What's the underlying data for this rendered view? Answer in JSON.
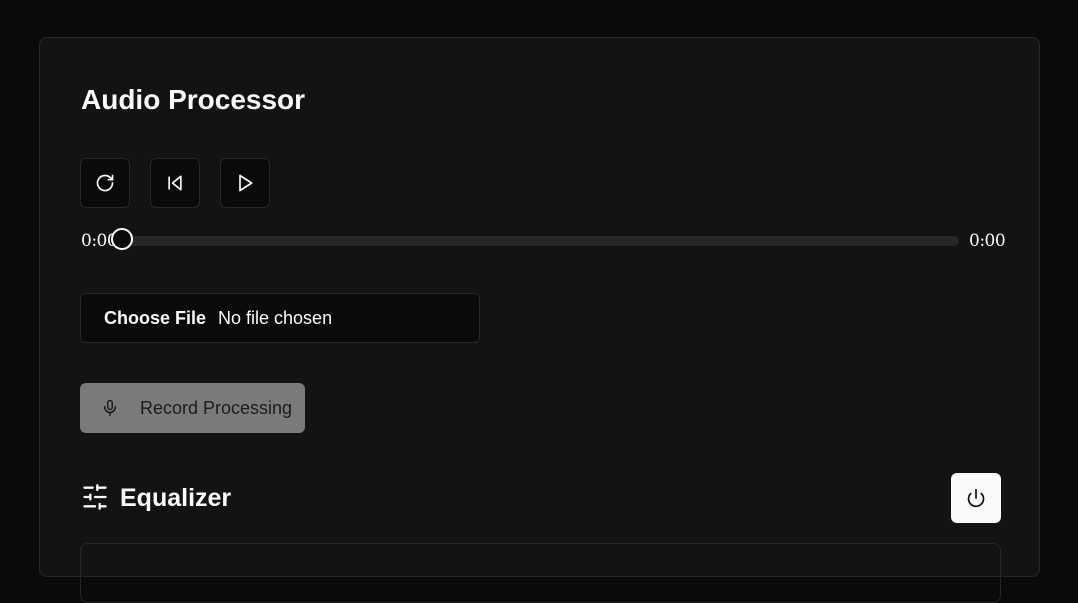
{
  "app": {
    "title": "Audio Processor"
  },
  "controls": {
    "reset_icon": "rotate-cw-icon",
    "skip_back_icon": "skip-back-icon",
    "play_icon": "play-icon"
  },
  "progress": {
    "current_time": "0:00",
    "duration": "0:00",
    "position_fraction": 0
  },
  "file_input": {
    "button_label": "Choose File",
    "status": "No file chosen"
  },
  "record": {
    "label": "Record Processing",
    "icon": "microphone-icon",
    "disabled": true
  },
  "equalizer": {
    "title": "Equalizer",
    "icon": "sliders-horizontal-icon",
    "power_icon": "power-icon"
  },
  "colors": {
    "background": "#0a0a0b",
    "card": "#131315",
    "border": "#27272a",
    "foreground": "#fafafa",
    "disabled_button": "#7a7a7b"
  }
}
